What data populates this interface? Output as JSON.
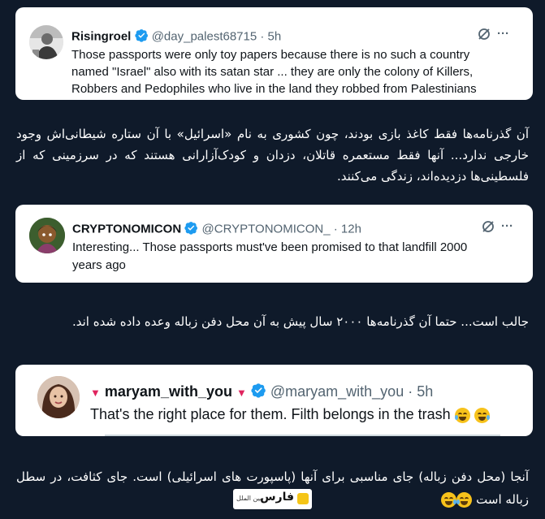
{
  "tweets": [
    {
      "name": "Risingroel",
      "handle": "@day_palest68715",
      "time": "5h",
      "avatar_icon": "bw-photo-avatar",
      "body_lines": [
        "Those passports were only toy papers because there is no such a country",
        "named \"Israel\" also with its satan star ... they are only the colony of Killers,",
        "Robbers and Pedophiles  who live in the land they robbed from Palestinians"
      ]
    },
    {
      "name": "CRYPTONOMICON",
      "handle": "@CRYPTONOMICON_",
      "time": "12h",
      "avatar_icon": "cartoon-avatar",
      "body_lines": [
        "Interesting... Those passports must've been promised to that landfill 2000",
        "years ago"
      ]
    },
    {
      "name_prefix": "▼",
      "name": "maryam_with_you",
      "name_suffix": "▼",
      "handle": "@maryam_with_you",
      "time": "5h",
      "avatar_icon": "woman-avatar",
      "body_lines": [
        "That's the right place for them. Filth belongs in the trash"
      ]
    }
  ],
  "separator": "·",
  "more": "···",
  "translations": [
    "آن گذرنامه‌ها فقط کاغذ بازی بودند، چون کشوری به نام «اسرائیل» با آن ستاره شیطانی‌اش وجود خارجی ندارد... آنها فقط مستعمره قاتلان، دزدان و کودک‌آزارانی هستند که در سرزمینی که از فلسطینی‌ها دزدیده‌اند، زندگی می‌کنند.",
    "جالب است... حتما آن گذرنامه‌ها ۲۰۰۰ سال پیش به آن محل دفن زباله وعده داده شده اند.",
    "آنجا (محل دفن زباله) جای مناسبی برای آنها (پاسپورت های اسرائیلی) است. جای کثافت، در سطل زباله است"
  ],
  "logo": {
    "main": "فارس",
    "sub": "بین الملل"
  },
  "colors": {
    "background": "#0f1a2a",
    "verified": "#1d9bf0",
    "heart": "#e0245e",
    "logo_accent": "#f5c518"
  }
}
